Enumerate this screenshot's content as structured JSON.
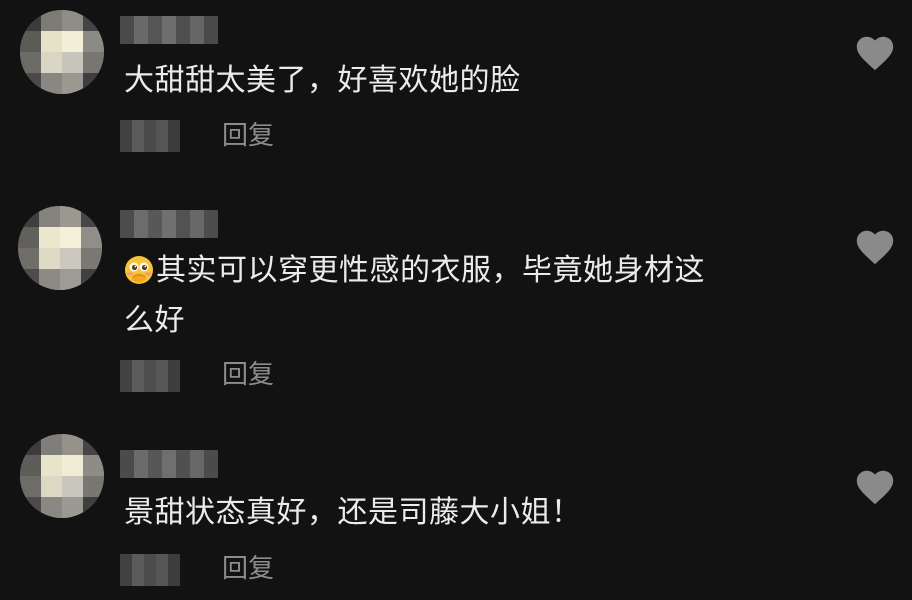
{
  "comments": [
    {
      "text_lines": [
        "大甜甜太美了，好喜欢她的脸"
      ],
      "emoji": null,
      "reply_label": "回复",
      "like_icon": "heart-outline-icon"
    },
    {
      "text_lines": [
        "其实可以穿更性感的衣服，毕竟她身材这",
        "么好"
      ],
      "emoji": "shy-face-emoji-icon",
      "reply_label": "回复",
      "like_icon": "heart-outline-icon"
    },
    {
      "text_lines": [
        "景甜状态真好，还是司藤大小姐！"
      ],
      "emoji": null,
      "reply_label": "回复",
      "like_icon": "heart-outline-icon"
    }
  ],
  "colors": {
    "background": "#121212",
    "comment_text": "#ebebeb",
    "secondary_text": "#8c8c8c",
    "heart": "#8a8a8a"
  }
}
